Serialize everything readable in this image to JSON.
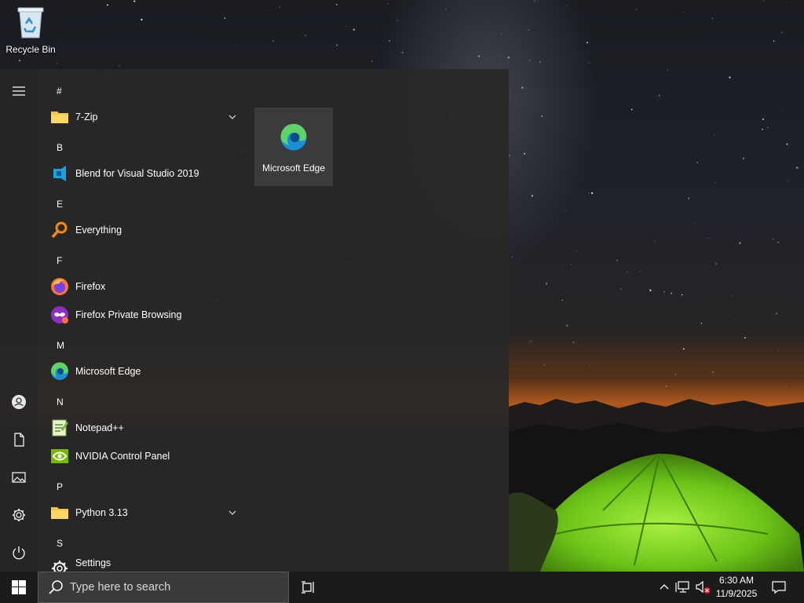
{
  "desktop": {
    "icons": [
      {
        "label": "Recycle Bin",
        "icon": "recycle-bin-icon"
      }
    ]
  },
  "start_menu": {
    "rail": [
      {
        "name": "hamburger-menu-icon"
      },
      {
        "name": "user-account-icon"
      },
      {
        "name": "documents-icon"
      },
      {
        "name": "pictures-icon"
      },
      {
        "name": "settings-gear-icon"
      },
      {
        "name": "power-icon"
      }
    ],
    "apps": [
      {
        "type": "header",
        "label": "#"
      },
      {
        "type": "app",
        "label": "7-Zip",
        "icon": "folder-icon",
        "expandable": true
      },
      {
        "type": "header",
        "label": "B"
      },
      {
        "type": "app",
        "label": "Blend for Visual Studio 2019",
        "icon": "blend-icon"
      },
      {
        "type": "header",
        "label": "E"
      },
      {
        "type": "app",
        "label": "Everything",
        "icon": "everything-search-icon"
      },
      {
        "type": "header",
        "label": "F"
      },
      {
        "type": "app",
        "label": "Firefox",
        "icon": "firefox-icon"
      },
      {
        "type": "app",
        "label": "Firefox Private Browsing",
        "icon": "firefox-private-icon"
      },
      {
        "type": "header",
        "label": "M"
      },
      {
        "type": "app",
        "label": "Microsoft Edge",
        "icon": "edge-icon"
      },
      {
        "type": "header",
        "label": "N"
      },
      {
        "type": "app",
        "label": "Notepad++",
        "icon": "notepad-plus-plus-icon"
      },
      {
        "type": "app",
        "label": "NVIDIA Control Panel",
        "icon": "nvidia-icon"
      },
      {
        "type": "header",
        "label": "P"
      },
      {
        "type": "app",
        "label": "Python 3.13",
        "icon": "folder-icon",
        "expandable": true
      },
      {
        "type": "header",
        "label": "S"
      },
      {
        "type": "app",
        "label": "Settings",
        "icon": "settings-gear-icon"
      }
    ],
    "tiles": [
      {
        "label": "Microsoft Edge",
        "icon": "edge-icon"
      }
    ]
  },
  "taskbar": {
    "search_placeholder": "Type here to search",
    "tray_icons": [
      "show-hidden-icons-chevron-icon",
      "network-disconnected-icon",
      "volume-muted-icon"
    ],
    "time": "6:30 AM",
    "date": "11/9/2025",
    "notifications_icon": "action-center-icon"
  },
  "colors": {
    "start_menu_bg": "#282828",
    "taskbar_bg": "#1b1b1b",
    "tile_bg": "#3b3b3b",
    "tent_green": "#7ed321"
  }
}
